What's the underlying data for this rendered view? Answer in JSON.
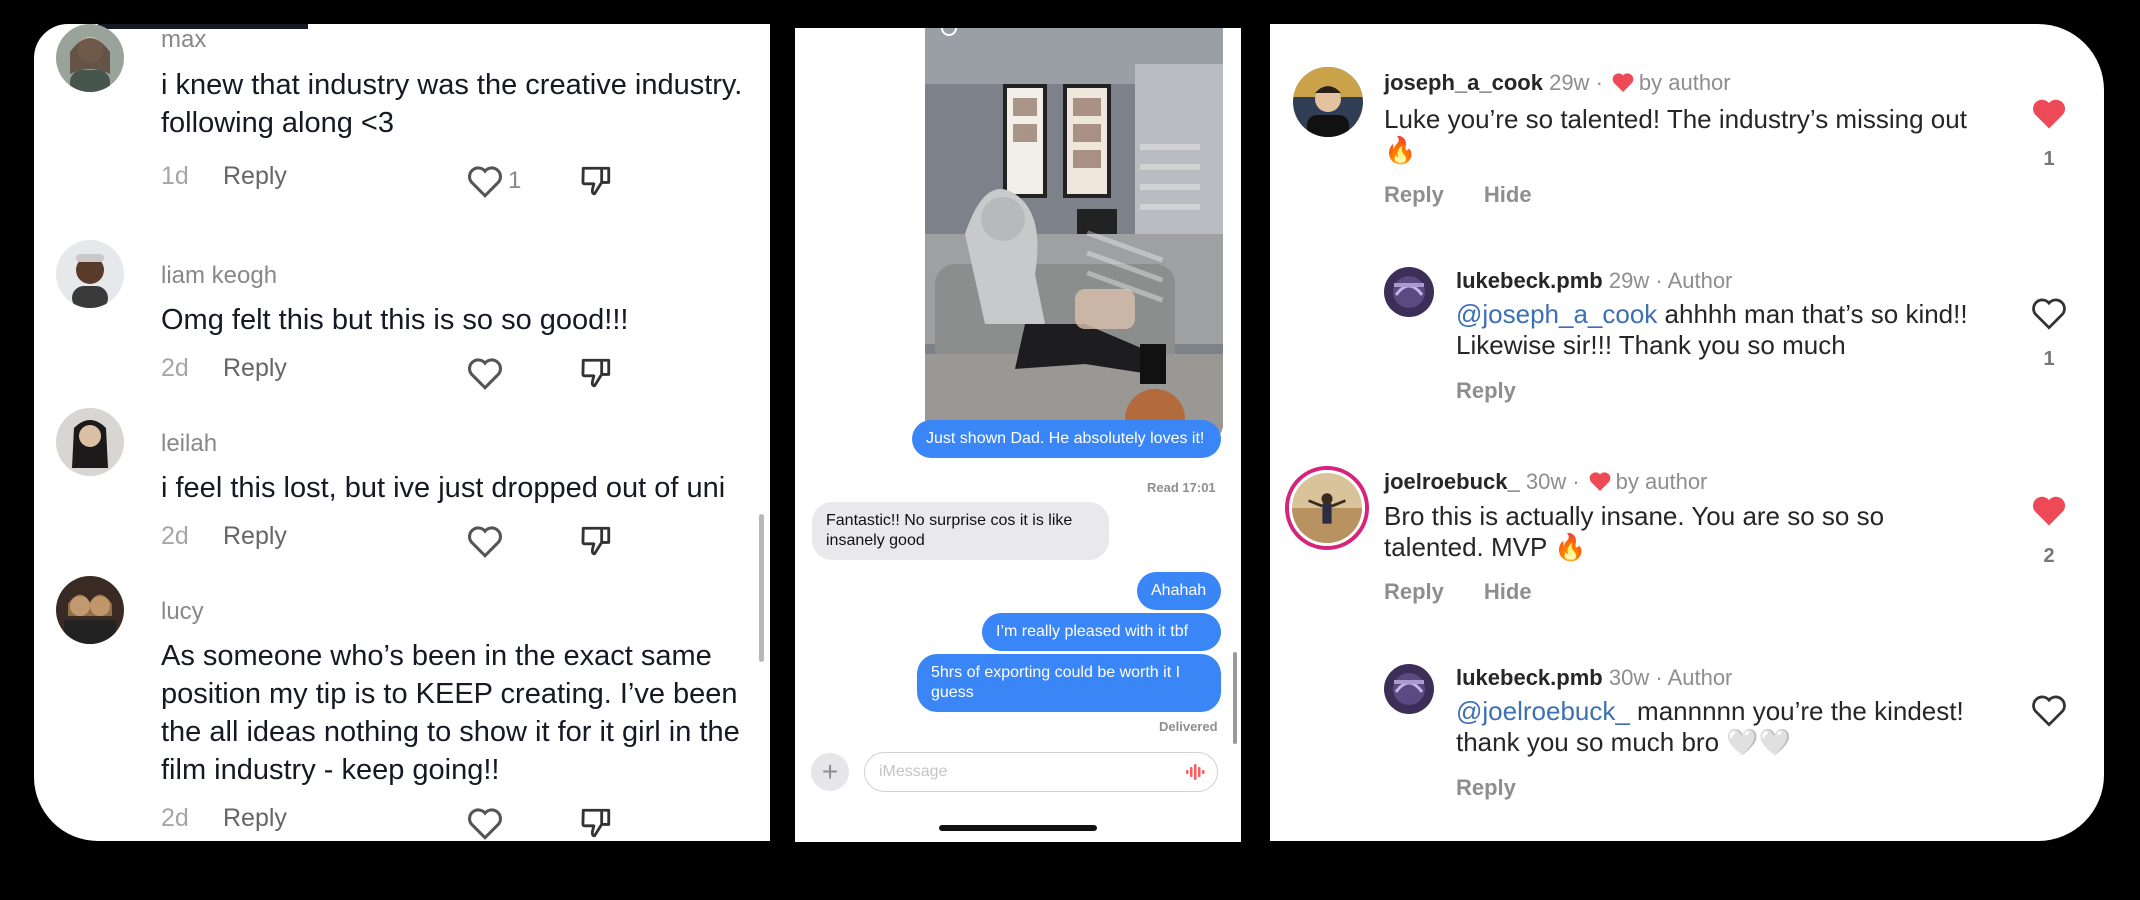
{
  "tiktok_comments": {
    "items": [
      {
        "username": "max",
        "text": "i knew that industry was the creative industry. following along <3",
        "age": "1d",
        "reply_label": "Reply",
        "like_count": "1"
      },
      {
        "username": "liam keogh",
        "text": "Omg felt this but this is so so good!!!",
        "age": "2d",
        "reply_label": "Reply",
        "like_count": ""
      },
      {
        "username": "leilah",
        "text": "i feel this lost, but ive just dropped out of uni",
        "age": "2d",
        "reply_label": "Reply",
        "like_count": ""
      },
      {
        "username": "lucy",
        "text": "As someone who’s been in the exact same position my tip is to KEEP creating. I’ve been the all ideas nothing to show it for it girl in the film industry - keep going!!",
        "age": "2d",
        "reply_label": "Reply",
        "like_count": ""
      }
    ]
  },
  "imessage": {
    "messages": [
      {
        "direction": "outgoing",
        "text": "Just shown Dad. He absolutely loves it!"
      },
      {
        "direction": "incoming",
        "text": "Fantastic!! No surprise cos it is like insanely good"
      },
      {
        "direction": "outgoing",
        "text": "Ahahah"
      },
      {
        "direction": "outgoing",
        "text": "I’m really pleased with it tbf"
      },
      {
        "direction": "outgoing",
        "text": "5hrs of exporting could be worth it I guess"
      }
    ],
    "read_receipt": "Read 17:01",
    "delivered_label": "Delivered",
    "input_placeholder": "iMessage",
    "plus_glyph": "+",
    "accent_color": "#3b86f7"
  },
  "instagram_comments": {
    "threads": [
      {
        "username": "joseph_a_cook",
        "age": "29w",
        "author_liked_label": "by author",
        "text": "Luke you’re so talented! The industry’s missing out 🔥",
        "reply_label": "Reply",
        "hide_label": "Hide",
        "like_count": "1",
        "liked": true,
        "reply": {
          "username": "lukebeck.pmb",
          "age": "29w",
          "badge": "Author",
          "mention": "@joseph_a_cook",
          "text": " ahhhh man that’s so kind!! Likewise sir!!! Thank you so much",
          "reply_label": "Reply",
          "like_count": "1",
          "liked": false
        }
      },
      {
        "username": "joelroebuck_",
        "age": "30w",
        "author_liked_label": "by author",
        "text": "Bro this is actually insane. You are so so so talented. MVP 🔥",
        "reply_label": "Reply",
        "hide_label": "Hide",
        "like_count": "2",
        "liked": true,
        "reply": {
          "username": "lukebeck.pmb",
          "age": "30w",
          "badge": "Author",
          "mention": "@joelroebuck_",
          "text": " mannnnn you’re the kindest! thank you so much bro 🤍🤍",
          "reply_label": "Reply",
          "like_count": "",
          "liked": false
        }
      }
    ],
    "separator": "·",
    "liked_color": "#ed4956"
  }
}
